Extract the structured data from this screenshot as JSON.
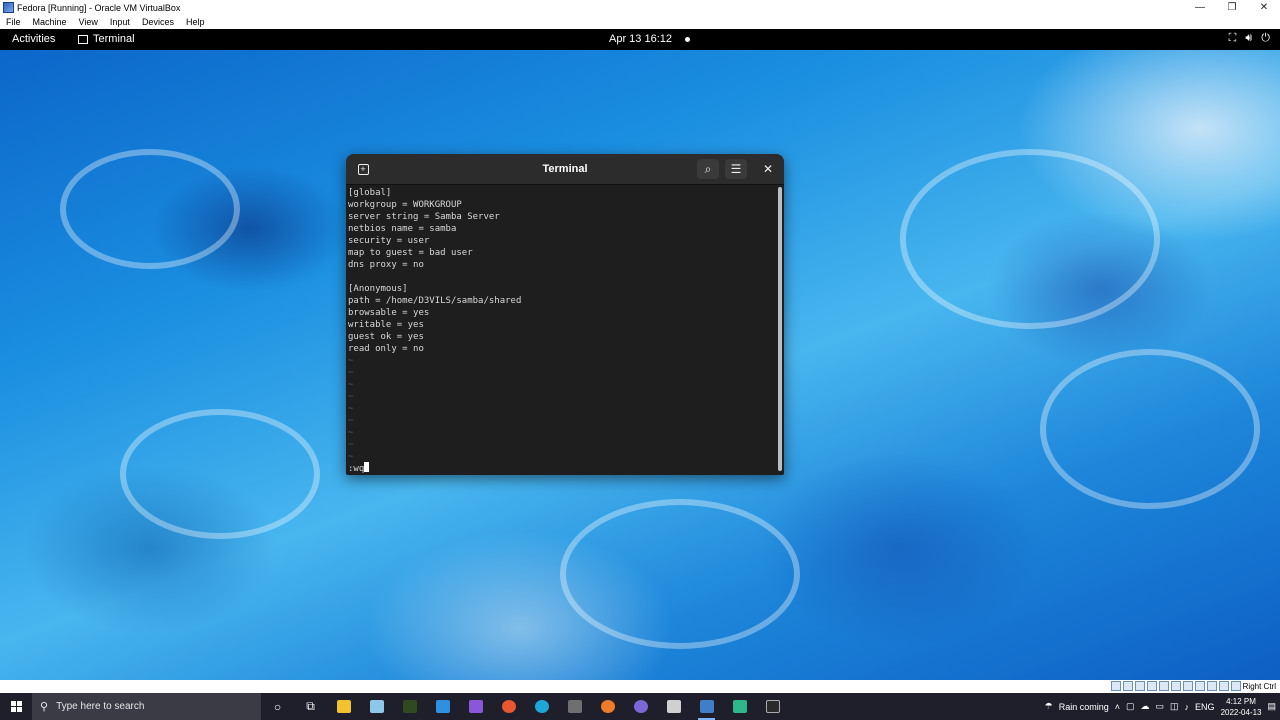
{
  "vbox": {
    "title": "Fedora [Running] - Oracle VM VirtualBox",
    "menu": [
      "File",
      "Machine",
      "View",
      "Input",
      "Devices",
      "Help"
    ],
    "controls": [
      "—",
      "❐",
      "✕"
    ],
    "status_host_key": "Right Ctrl"
  },
  "gnome": {
    "activities": "Activities",
    "app_name": "Terminal",
    "datetime": "Apr 13  16:12",
    "tray_icons": [
      "network-icon",
      "volume-icon",
      "power-icon"
    ]
  },
  "terminal": {
    "title": "Terminal",
    "lines": [
      "[global]",
      "workgroup = WORKGROUP",
      "server string = Samba Server",
      "netbios name = samba",
      "security = user",
      "map to guest = bad user",
      "dns proxy = no",
      "",
      "[Anonymous]",
      "path = /home/D3VILS/samba/shared",
      "browsable = yes",
      "writable = yes",
      "guest ok = yes",
      "read only = no"
    ],
    "tildes": [
      "~",
      "~",
      "~",
      "~",
      "~",
      "~",
      "~",
      "~",
      "~"
    ],
    "command": ":wq"
  },
  "taskbar": {
    "search_placeholder": "Type here to search",
    "weather": "Rain coming",
    "language": "ENG",
    "time": "4:12 PM",
    "date": "2022-04-13",
    "apps": [
      {
        "name": "cortana-icon",
        "glyph": "○",
        "color": "#ffffff"
      },
      {
        "name": "task-view-icon",
        "glyph": "⧉",
        "color": "#ffffff"
      },
      {
        "name": "file-explorer-icon",
        "glyph": "",
        "color": "#f2c230"
      },
      {
        "name": "notepad-icon",
        "glyph": "",
        "color": "#8fc7e8"
      },
      {
        "name": "nvidia-icon",
        "glyph": "",
        "color": "#2f4a1e"
      },
      {
        "name": "vscode-icon",
        "glyph": "",
        "color": "#2f8fe0"
      },
      {
        "name": "visual-studio-icon",
        "glyph": "",
        "color": "#8a57d8"
      },
      {
        "name": "git-icon",
        "glyph": "",
        "color": "#e8572f"
      },
      {
        "name": "edge-icon",
        "glyph": "",
        "color": "#1fa6d8"
      },
      {
        "name": "gpu-app-icon",
        "glyph": "",
        "color": "#6f6f6f"
      },
      {
        "name": "firefox-icon",
        "glyph": "",
        "color": "#f07a2a"
      },
      {
        "name": "discord-icon",
        "glyph": "",
        "color": "#7b68d6"
      },
      {
        "name": "unity-icon",
        "glyph": "",
        "color": "#d0d0d0"
      },
      {
        "name": "virtualbox-icon",
        "glyph": "",
        "color": "#3f7ec8"
      },
      {
        "name": "android-studio-icon",
        "glyph": "",
        "color": "#2db78a"
      },
      {
        "name": "terminal-app-icon",
        "glyph": "",
        "color": "#2a2a2a"
      }
    ]
  }
}
